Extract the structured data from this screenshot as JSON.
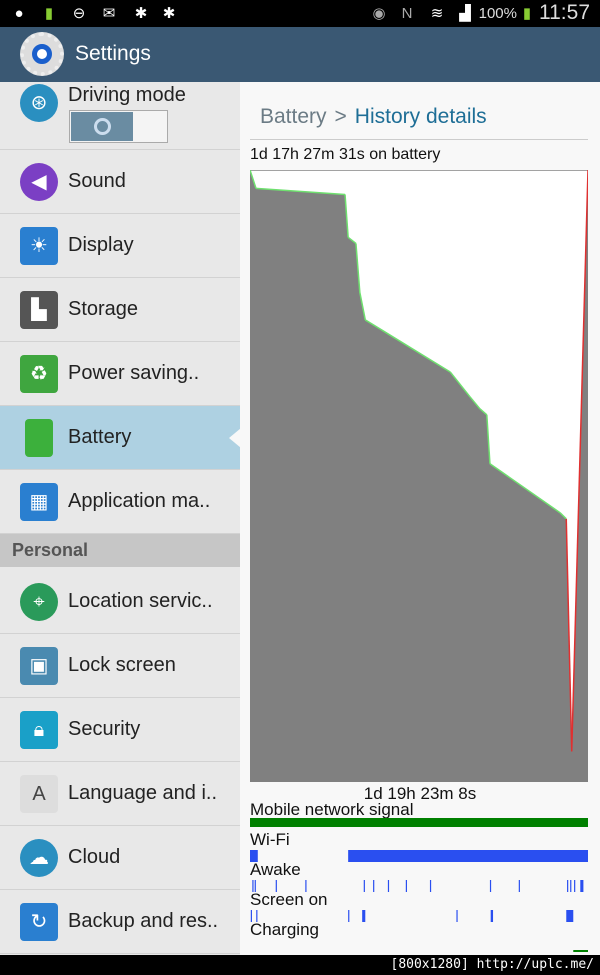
{
  "status_bar": {
    "icons": [
      "messenger-icon",
      "battery-full-icon",
      "do-not-disturb-icon",
      "gmail-icon",
      "app-icon",
      "app-icon",
      "eye-icon",
      "nfc-icon",
      "wifi-icon",
      "signal-icon"
    ],
    "battery_percent": "100%",
    "time": "11:57",
    "battery_badge": "100%"
  },
  "action_bar": {
    "title": "Settings"
  },
  "sidebar": {
    "items": [
      {
        "label": "Driving mode",
        "icon": "steering-wheel-icon",
        "color": "#2a8fc0"
      },
      {
        "label": "Sound",
        "icon": "speaker-icon",
        "color": "#7b3fc4"
      },
      {
        "label": "Display",
        "icon": "brightness-icon",
        "color": "#2a7fd0"
      },
      {
        "label": "Storage",
        "icon": "sd-card-icon",
        "color": "#555555"
      },
      {
        "label": "Power saving..",
        "icon": "recycle-battery-icon",
        "color": "#3fa63f"
      },
      {
        "label": "Battery",
        "icon": "battery-icon",
        "color": "#3cb03c"
      },
      {
        "label": "Application ma..",
        "icon": "grid-icon",
        "color": "#2a7fd0"
      }
    ],
    "section_header": "Personal",
    "personal_items": [
      {
        "label": "Location servic..",
        "icon": "location-icon",
        "color": "#2a9a5a"
      },
      {
        "label": "Lock screen",
        "icon": "lock-screen-icon",
        "color": "#4a8ab0"
      },
      {
        "label": "Security",
        "icon": "lock-icon",
        "color": "#1aa0c8"
      },
      {
        "label": "Language and i..",
        "icon": "keyboard-icon",
        "color": "#999999"
      },
      {
        "label": "Cloud",
        "icon": "cloud-icon",
        "color": "#2a8fc0"
      },
      {
        "label": "Backup and res..",
        "icon": "backup-icon",
        "color": "#2a7fd0"
      }
    ],
    "selected": "Battery",
    "driving_toggle_on": false
  },
  "breadcrumb": {
    "parent": "Battery",
    "separator": ">",
    "current": "History details"
  },
  "on_battery": "1d 17h 27m 31s on battery",
  "chart_data": {
    "type": "area",
    "xlabel": "1d 19h 23m 8s",
    "x_unit": "hours",
    "xlim": [
      0,
      43.39
    ],
    "ylim": [
      0,
      100
    ],
    "y_unit": "percent",
    "grid": false,
    "colors": {
      "fill": "#808080",
      "line": "#6fe06f",
      "low": "#e03030",
      "mid": "#f0f060"
    },
    "series": [
      {
        "x": [
          0,
          0.77,
          12.2,
          12.6,
          13.6,
          14.1,
          14.8,
          25.7,
          28.2,
          29.5,
          30.4,
          30.8,
          39.8,
          40.6,
          41.3,
          43.39
        ],
        "y": [
          100,
          97,
          96,
          89,
          88,
          80,
          75.5,
          67,
          63,
          61,
          60,
          52,
          44,
          43,
          5,
          100
        ]
      }
    ],
    "tracks": [
      {
        "name": "Mobile network signal",
        "color": "#008000",
        "intervals": [
          [
            0,
            43.39
          ]
        ]
      },
      {
        "name": "Wi-Fi",
        "color": "#2a4ff0",
        "intervals": [
          [
            0,
            1.0
          ],
          [
            12.6,
            43.39
          ]
        ]
      },
      {
        "name": "Awake",
        "color": "#2a4ff0",
        "ticks": [
          0.3,
          0.6,
          3.3,
          7.1,
          14.6,
          15.8,
          17.7,
          20.0,
          23.1,
          30.8,
          34.5,
          40.7,
          41.1,
          41.6
        ],
        "intervals": [
          [
            42.4,
            42.8
          ]
        ]
      },
      {
        "name": "Screen on",
        "color": "#2a4ff0",
        "ticks": [
          0.1,
          0.8,
          12.6,
          26.5
        ],
        "intervals": [
          [
            14.4,
            14.8
          ],
          [
            30.9,
            31.2
          ],
          [
            40.6,
            41.5
          ]
        ]
      },
      {
        "name": "Charging",
        "color": "#008000",
        "intervals": [
          [
            41.5,
            43.39
          ]
        ]
      }
    ]
  },
  "watermark": "[800x1280] http://uplc.me/"
}
